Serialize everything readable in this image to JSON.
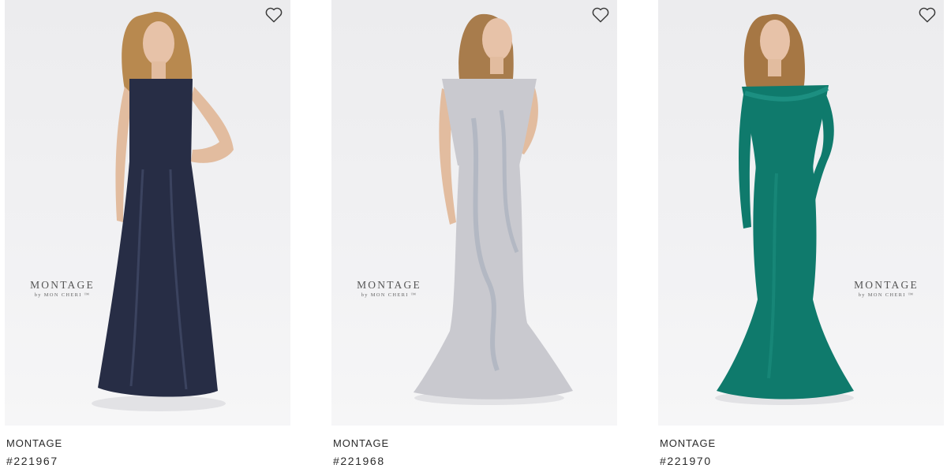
{
  "products": [
    {
      "brand": "MONTAGE",
      "sku": "#221967",
      "logo": {
        "line1": "MONTAGE",
        "line2": "by MON CHERI ™"
      },
      "dress_color": "#272d45",
      "dress_highlight": "#4a5272"
    },
    {
      "brand": "MONTAGE",
      "sku": "#221968",
      "logo": {
        "line1": "MONTAGE",
        "line2": "by MON CHERI ™"
      },
      "dress_color": "#c9c9cf",
      "dress_highlight": "#e6e6ea"
    },
    {
      "brand": "MONTAGE",
      "sku": "#221970",
      "logo": {
        "line1": "MONTAGE",
        "line2": "by MON CHERI ™"
      },
      "dress_color": "#0f7a6c",
      "dress_highlight": "#22998a"
    }
  ],
  "icons": {
    "favorite": "heart-outline-icon"
  }
}
